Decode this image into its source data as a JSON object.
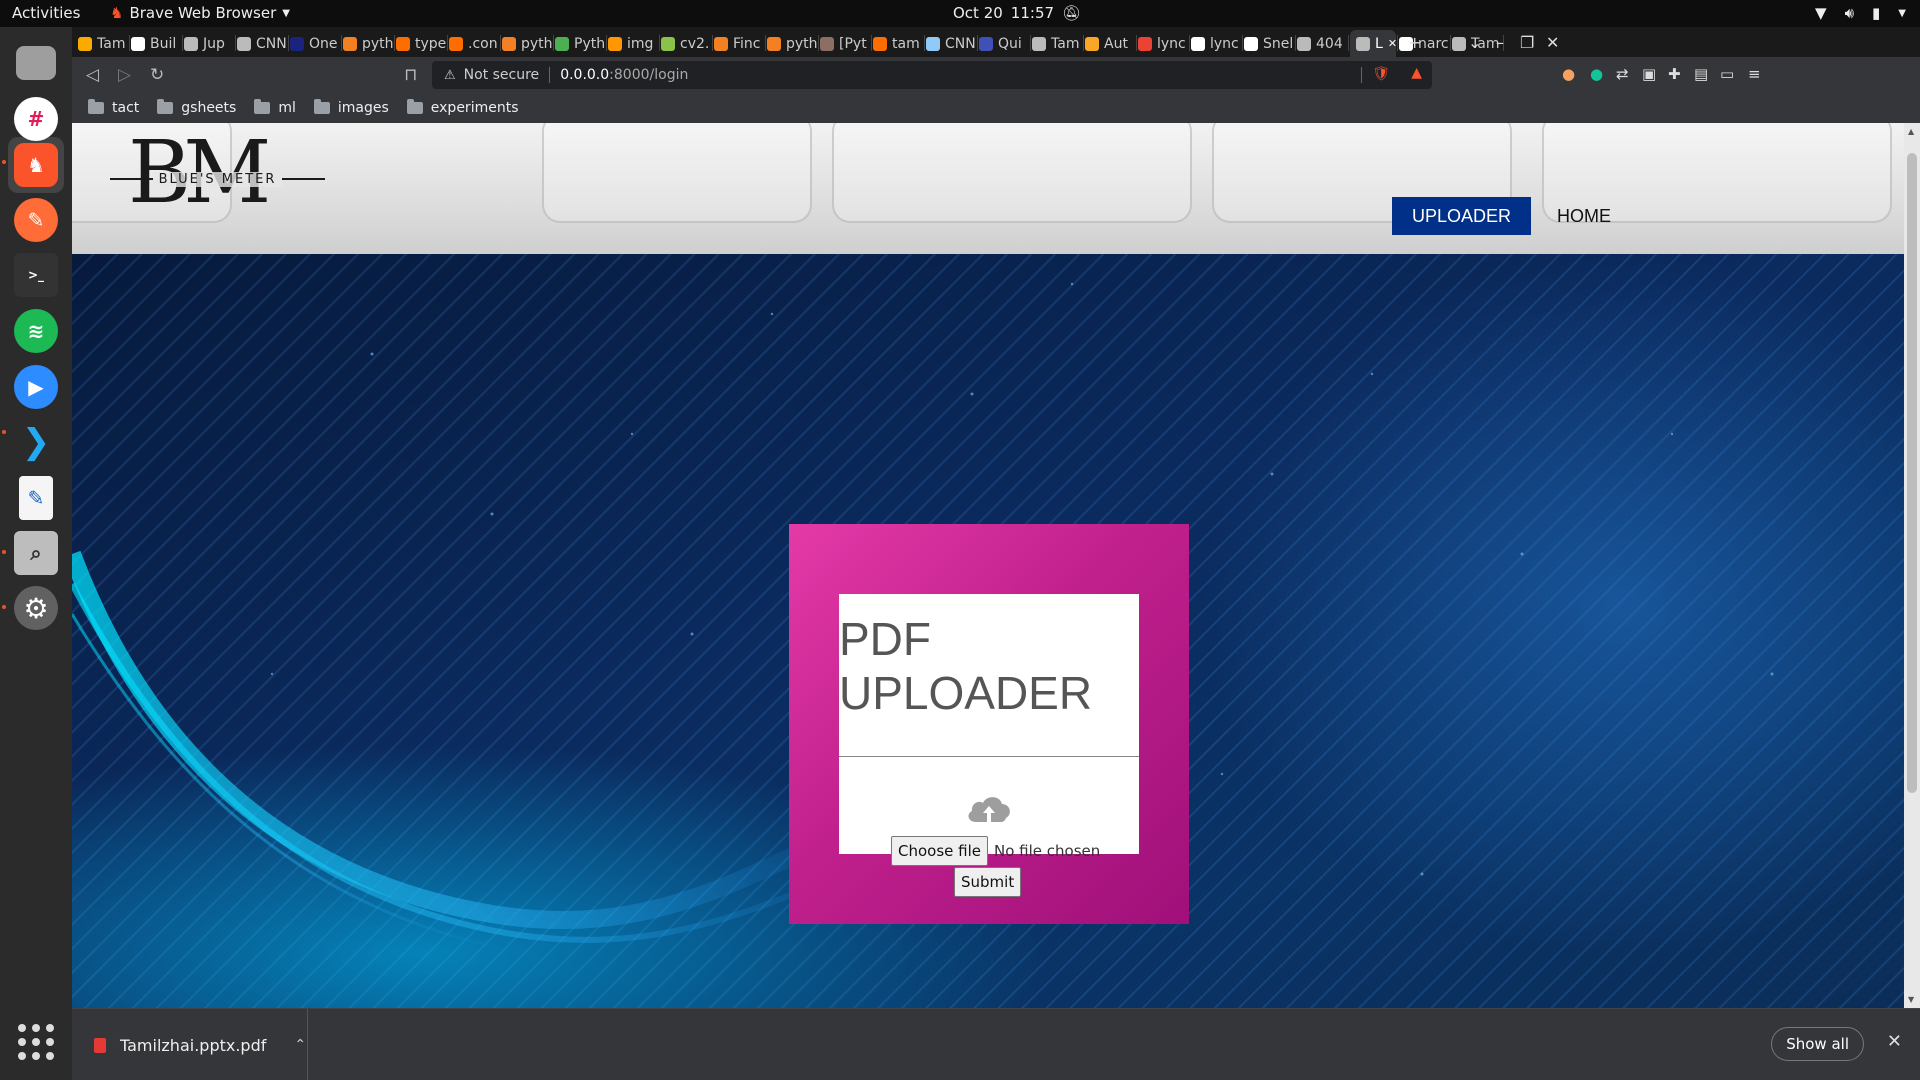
{
  "system": {
    "activities": "Activities",
    "app_name": "Brave Web Browser",
    "date": "Oct 20",
    "time": "11:57"
  },
  "tabs": [
    {
      "label": "Tam",
      "color": "#f9ab00"
    },
    {
      "label": "Buil",
      "color": "#ffffff"
    },
    {
      "label": "Jup",
      "color": "#bbbbbb"
    },
    {
      "label": "CNN",
      "color": "#bbbbbb"
    },
    {
      "label": "One",
      "color": "#1a237e"
    },
    {
      "label": "pyth",
      "color": "#f48024"
    },
    {
      "label": "type",
      "color": "#ff6d00"
    },
    {
      "label": ".con",
      "color": "#ff6d00"
    },
    {
      "label": "pyth",
      "color": "#f48024"
    },
    {
      "label": "Pyth",
      "color": "#4caf50"
    },
    {
      "label": "img",
      "color": "#ff9800"
    },
    {
      "label": "cv2.",
      "color": "#8bc34a"
    },
    {
      "label": "Finc",
      "color": "#f48024"
    },
    {
      "label": "pyth",
      "color": "#f48024"
    },
    {
      "label": "[Pyt",
      "color": "#8d6e63"
    },
    {
      "label": "tam",
      "color": "#ff6d00"
    },
    {
      "label": "CNN",
      "color": "#90caf9"
    },
    {
      "label": "Qui",
      "color": "#3f51b5"
    },
    {
      "label": "Tam",
      "color": "#bbbbbb"
    },
    {
      "label": "Aut",
      "color": "#f9a825"
    },
    {
      "label": "lync",
      "color": "#ea4335"
    },
    {
      "label": "lync",
      "color": "#ffffff"
    },
    {
      "label": "Snel",
      "color": "#ffffff"
    },
    {
      "label": "404",
      "color": "#bbbbbb"
    },
    {
      "label": "L",
      "color": "#bbbbbb",
      "active": true
    },
    {
      "label": "narc",
      "color": "#ffffff"
    },
    {
      "label": "Tam",
      "color": "#bbbbbb"
    }
  ],
  "address": {
    "security": "Not secure",
    "host": "0.0.0.0",
    "path": ":8000/login"
  },
  "bookmarks": [
    "tact",
    "gsheets",
    "ml",
    "images",
    "experiments"
  ],
  "site": {
    "logo_letters": "BM",
    "logo_tagline": "BLUE'S METER",
    "nav": [
      {
        "label": "UPLOADER",
        "active": true
      },
      {
        "label": "HOME",
        "active": false
      }
    ],
    "upload_title": "PDF UPLOADER",
    "choose_file": "Choose file",
    "file_status": "No file chosen",
    "submit": "Submit"
  },
  "downloads": {
    "file_name": "Tamilzhai.pptx.pdf",
    "show_all": "Show all"
  },
  "colors": {
    "nav_active_bg": "#003087",
    "card_gradient_start": "#e43aa8",
    "card_gradient_end": "#a0107a"
  }
}
